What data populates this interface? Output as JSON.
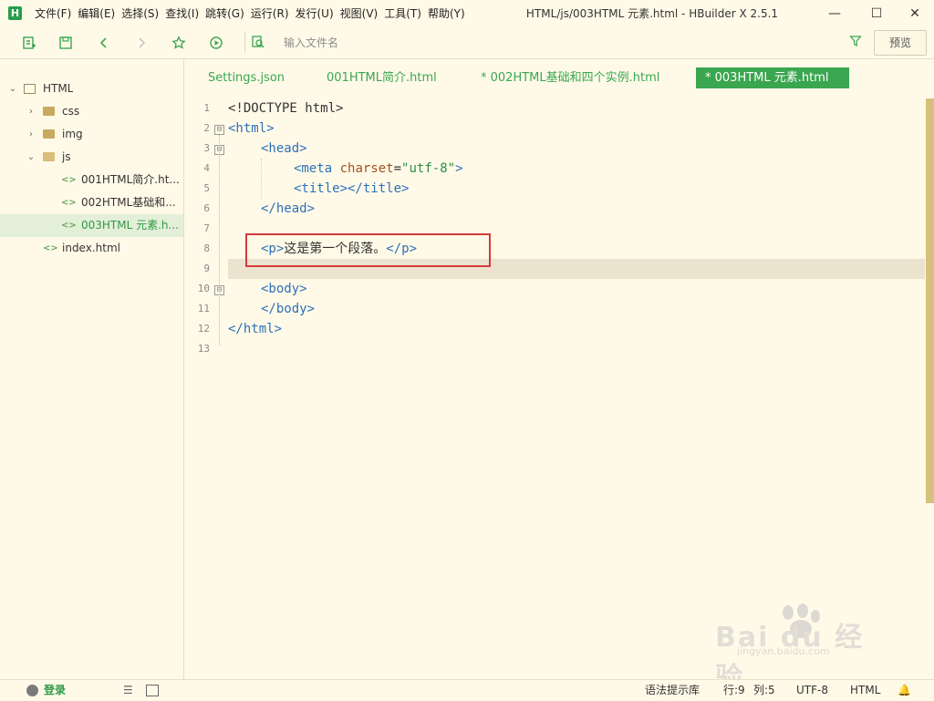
{
  "app": {
    "logo_letter": "H",
    "window_title": "HTML/js/003HTML 元素.html - HBuilder X 2.5.1",
    "window_controls": {
      "minimize": "—",
      "maximize": "☐",
      "close": "✕"
    }
  },
  "menu": [
    "文件(F)",
    "编辑(E)",
    "选择(S)",
    "查找(I)",
    "跳转(G)",
    "运行(R)",
    "发行(U)",
    "视图(V)",
    "工具(T)",
    "帮助(Y)"
  ],
  "toolbar": {
    "icons": [
      "new-file-icon",
      "save-icon",
      "back-icon",
      "forward-icon",
      "star-icon",
      "run-icon",
      "file-search-icon",
      "filter-icon"
    ],
    "search_placeholder": "输入文件名",
    "preview_label": "预览"
  },
  "sidebar": {
    "root": "HTML",
    "folders": [
      "css",
      "img",
      "js"
    ],
    "js_files": [
      "001HTML简介.ht...",
      "002HTML基础和...",
      "003HTML 元素.h..."
    ],
    "selected": "003HTML 元素.h...",
    "root_files": [
      "index.html"
    ]
  },
  "tabs": [
    {
      "label": "Settings.json",
      "active": false
    },
    {
      "label": "001HTML简介.html",
      "active": false
    },
    {
      "label": "* 002HTML基础和四个实例.html",
      "active": false
    },
    {
      "label": "* 003HTML 元素.html",
      "active": true
    }
  ],
  "editor": {
    "line_numbers": [
      "1",
      "2",
      "3",
      "4",
      "5",
      "6",
      "7",
      "8",
      "9",
      "10",
      "11",
      "12",
      "13"
    ],
    "fold_markers": [
      "⊟",
      "⊟",
      "⊟"
    ],
    "lines": {
      "l1": "<!DOCTYPE html>",
      "l2_open": "<html>",
      "l3_open": "<head>",
      "l4_meta_tag": "<meta",
      "l4_attr": "charset",
      "l4_eq": "=",
      "l4_value": "\"utf-8\"",
      "l4_close": ">",
      "l5_title": "<title></title>",
      "l6_head_close": "</head>",
      "l8_p_open": "<p>",
      "l8_text": "这是第一个段落。",
      "l8_p_close": "</p>",
      "l10_body_open": "<body>",
      "l11_body_close": "</body>",
      "l12_html_close": "</html>"
    },
    "current_line": 9
  },
  "status": {
    "login": "登录",
    "syntax_lib": "语法提示库",
    "position_row": "行:9",
    "position_col": "列:5",
    "encoding": "UTF-8",
    "language": "HTML"
  },
  "watermark": {
    "brand": "Bai du 经验",
    "url": "jingyan.baidu.com"
  },
  "colors": {
    "accent": "#3aa64f",
    "background": "#fffae8",
    "highlight_box": "#d33b3b"
  }
}
